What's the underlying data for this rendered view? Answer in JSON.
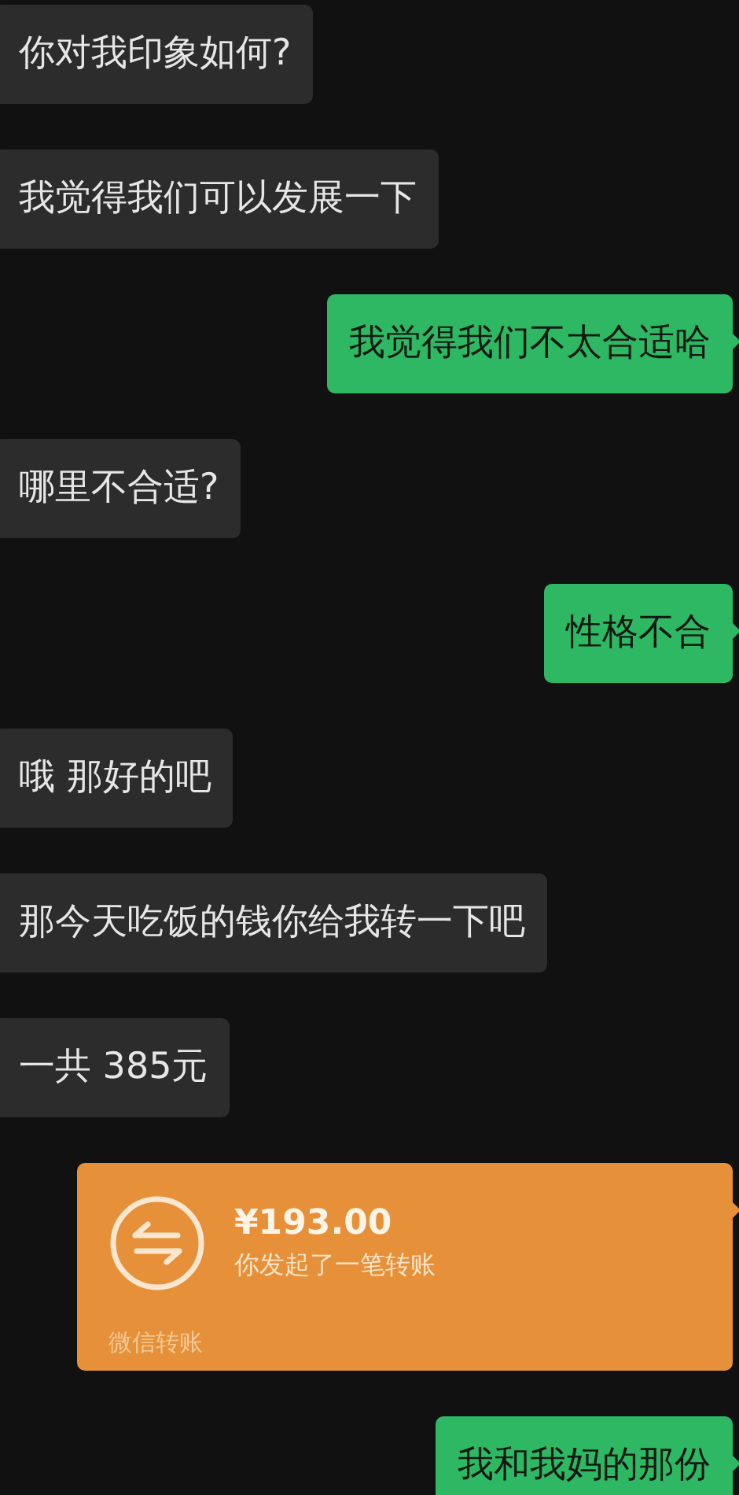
{
  "messages": [
    {
      "kind": "text",
      "outgoing": false,
      "text": "你对我印象如何?"
    },
    {
      "kind": "text",
      "outgoing": false,
      "text": "我觉得我们可以发展一下"
    },
    {
      "kind": "text",
      "outgoing": true,
      "text": "我觉得我们不太合适哈"
    },
    {
      "kind": "text",
      "outgoing": false,
      "text": "哪里不合适?"
    },
    {
      "kind": "text",
      "outgoing": true,
      "text": "性格不合"
    },
    {
      "kind": "text",
      "outgoing": false,
      "text": "哦 那好的吧"
    },
    {
      "kind": "text",
      "outgoing": false,
      "text": "那今天吃饭的钱你给我转一下吧"
    },
    {
      "kind": "text",
      "outgoing": false,
      "text": "一共 385元"
    },
    {
      "kind": "transfer",
      "outgoing": true,
      "amount": "¥193.00",
      "note": "你发起了一笔转账",
      "footer": "微信转账"
    },
    {
      "kind": "text",
      "outgoing": true,
      "text": "我和我妈的那份"
    }
  ]
}
